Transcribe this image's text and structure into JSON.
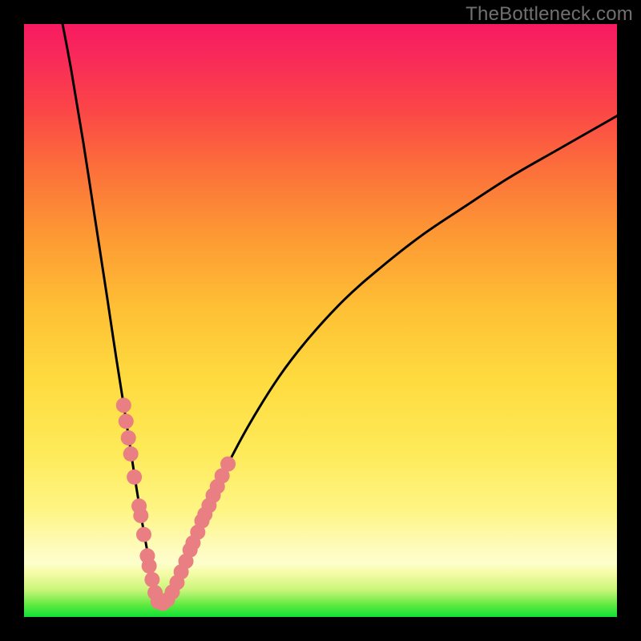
{
  "watermark": "TheBottleneck.com",
  "colors": {
    "frame": "#000000",
    "curve": "#000000",
    "marker_fill": "#e97f82",
    "marker_stroke": "#d86e72"
  },
  "chart_data": {
    "type": "line",
    "title": "",
    "xlabel": "",
    "ylabel": "",
    "xlim": [
      0,
      100
    ],
    "ylim": [
      0,
      100
    ],
    "note": "V-shaped bottleneck curve. Minimum (0) around x≈23. Left branch nearly vertical; right branch rises with decreasing slope toward ~85 at x=100. Pink markers cluster along both branches near the trough (roughly y 3–36).",
    "series": [
      {
        "name": "left-branch",
        "x": [
          6.5,
          8,
          10,
          12,
          14,
          15.5,
          17,
          18,
          19,
          20,
          21,
          22,
          22.7
        ],
        "y": [
          100,
          92,
          80,
          67,
          54,
          44,
          34.5,
          28,
          21.5,
          15.5,
          10,
          5,
          1.5
        ]
      },
      {
        "name": "right-branch",
        "x": [
          22.7,
          25,
          27,
          29,
          31,
          34,
          38,
          43,
          48,
          54,
          60,
          67,
          74,
          82,
          90,
          100
        ],
        "y": [
          1.5,
          4,
          8.5,
          13.5,
          18.5,
          25,
          32.5,
          40.5,
          47,
          53.5,
          58.8,
          64.3,
          69,
          74.2,
          78.8,
          84.5
        ]
      }
    ],
    "markers": [
      {
        "x": 16.8,
        "y": 35.7
      },
      {
        "x": 17.2,
        "y": 33.0
      },
      {
        "x": 17.6,
        "y": 30.2
      },
      {
        "x": 18.0,
        "y": 27.5
      },
      {
        "x": 18.6,
        "y": 23.6
      },
      {
        "x": 19.4,
        "y": 18.7
      },
      {
        "x": 19.7,
        "y": 17.1
      },
      {
        "x": 20.2,
        "y": 13.9
      },
      {
        "x": 20.8,
        "y": 10.3
      },
      {
        "x": 21.1,
        "y": 8.6
      },
      {
        "x": 21.6,
        "y": 6.3
      },
      {
        "x": 22.1,
        "y": 4.1
      },
      {
        "x": 22.6,
        "y": 2.6
      },
      {
        "x": 23.4,
        "y": 2.3
      },
      {
        "x": 24.2,
        "y": 2.9
      },
      {
        "x": 25.0,
        "y": 4.2
      },
      {
        "x": 25.8,
        "y": 5.8
      },
      {
        "x": 26.5,
        "y": 7.6
      },
      {
        "x": 27.3,
        "y": 9.4
      },
      {
        "x": 28.0,
        "y": 11.3
      },
      {
        "x": 28.5,
        "y": 12.5
      },
      {
        "x": 29.3,
        "y": 14.3
      },
      {
        "x": 30.0,
        "y": 16.2
      },
      {
        "x": 30.5,
        "y": 17.3
      },
      {
        "x": 31.2,
        "y": 18.8
      },
      {
        "x": 31.9,
        "y": 20.5
      },
      {
        "x": 32.6,
        "y": 22.0
      },
      {
        "x": 33.4,
        "y": 23.8
      },
      {
        "x": 34.4,
        "y": 25.8
      }
    ]
  }
}
